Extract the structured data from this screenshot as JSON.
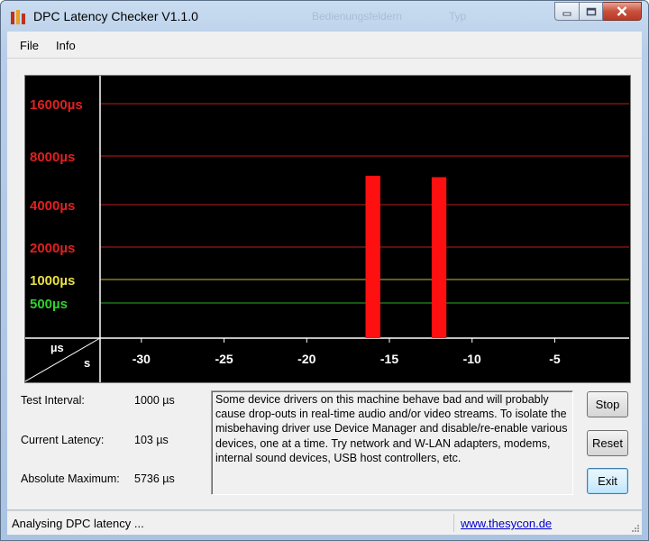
{
  "window": {
    "title": "DPC Latency Checker V1.1.0",
    "background_titles": [
      "Bedienungsfeldern",
      "Typ"
    ]
  },
  "menu": {
    "items": [
      "File",
      "Info"
    ]
  },
  "chart_data": {
    "type": "bar",
    "ylabels": [
      {
        "text": "16000µs",
        "value": 16000,
        "color": "#e02020"
      },
      {
        "text": "8000µs",
        "value": 8000,
        "color": "#e02020"
      },
      {
        "text": "4000µs",
        "value": 4000,
        "color": "#e02020"
      },
      {
        "text": "2000µs",
        "value": 2000,
        "color": "#e02020"
      },
      {
        "text": "1000µs",
        "value": 1000,
        "color": "#e8e040"
      },
      {
        "text": "500µs",
        "value": 500,
        "color": "#30d030"
      }
    ],
    "axis_corner": {
      "y_unit": "µs",
      "x_unit": "s"
    },
    "xticks": [
      "-30",
      "-25",
      "-20",
      "-15",
      "-10",
      "-5"
    ],
    "x": [
      -32,
      -31,
      -30,
      -29,
      -28,
      -27,
      -26,
      -25,
      -24,
      -23,
      -22,
      -21,
      -20,
      -19,
      -18,
      -17,
      -16,
      -15,
      -14,
      -13,
      -12,
      -11,
      -10,
      -9,
      -8,
      -7,
      -6,
      -5,
      -4,
      -3,
      -2,
      -1
    ],
    "values": [
      190,
      170,
      140,
      200,
      200,
      190,
      190,
      180,
      190,
      190,
      160,
      170,
      170,
      170,
      160,
      200,
      5736,
      150,
      200,
      190,
      5600,
      190,
      170,
      200,
      200,
      230,
      200,
      160,
      190,
      170,
      160,
      180
    ],
    "alert_threshold": 2000,
    "colors": {
      "normal": "#22d022",
      "alert": "#ff1010",
      "background": "#000000"
    }
  },
  "stats": {
    "test_interval_label": "Test Interval:",
    "test_interval_value": "1000 µs",
    "current_latency_label": "Current Latency:",
    "current_latency_value": "103 µs",
    "absolute_maximum_label": "Absolute Maximum:",
    "absolute_maximum_value": "5736 µs"
  },
  "message": "Some device drivers on this machine behave bad and will probably cause drop-outs in real-time audio and/or video streams. To isolate the misbehaving driver use Device Manager and disable/re-enable various devices, one at a time. Try network and W-LAN adapters, modems, internal sound devices, USB host controllers, etc.",
  "buttons": {
    "stop": "Stop",
    "reset": "Reset",
    "exit": "Exit"
  },
  "status": {
    "text": "Analysing DPC latency ...",
    "link": "www.thesycon.de"
  }
}
